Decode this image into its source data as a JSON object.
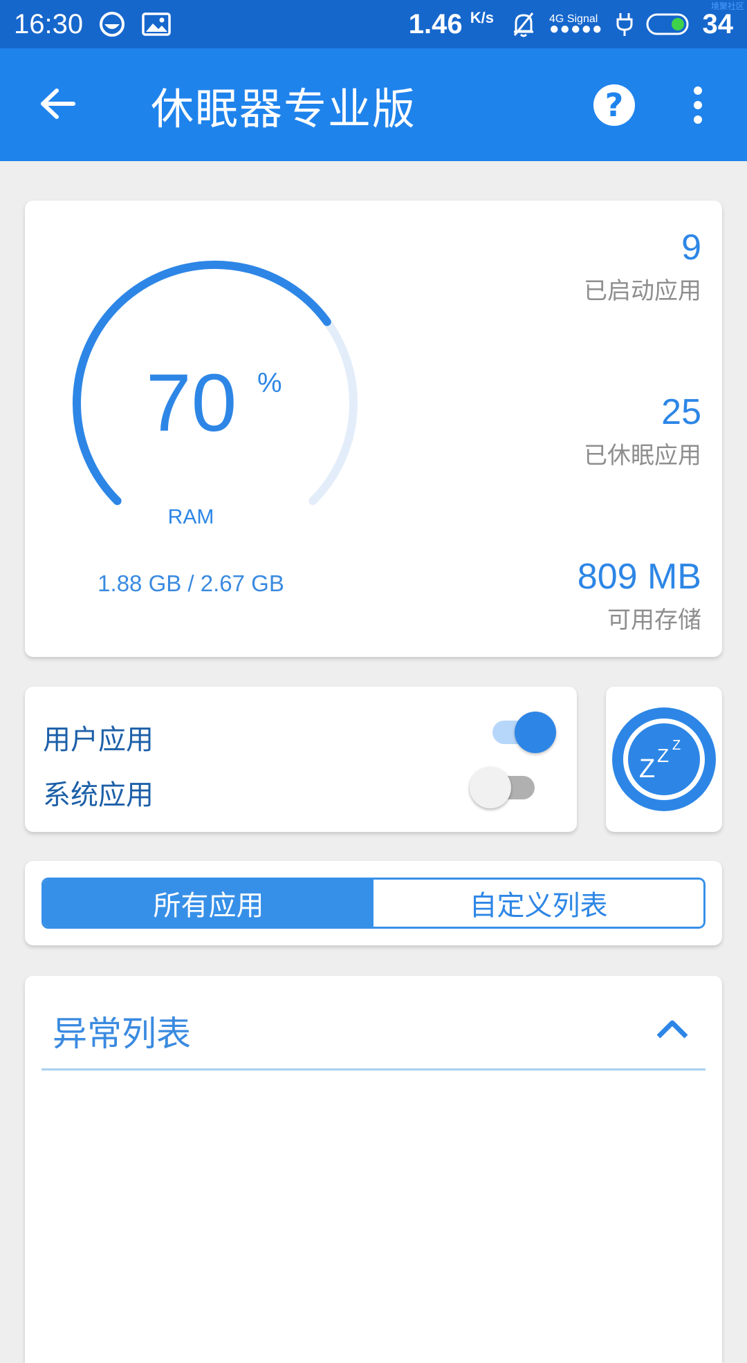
{
  "status_bar": {
    "time": "16:30",
    "speed_value": "1.46",
    "speed_unit": "K/s",
    "network_label": "4G",
    "signal_label": "Signal",
    "battery_level": "34",
    "watermark": "境聚社区"
  },
  "app_bar": {
    "title": "休眠器专业版",
    "help_symbol": "?"
  },
  "ram": {
    "percent_value": "70",
    "percent_sign": "%",
    "percent": 70,
    "label": "RAM",
    "usage": "1.88 GB / 2.67 GB"
  },
  "stats": [
    {
      "value": "9",
      "label": "已启动应用"
    },
    {
      "value": "25",
      "label": "已休眠应用"
    },
    {
      "value": "809 MB",
      "label": "可用存储"
    }
  ],
  "toggles": {
    "user_apps_label": "用户应用",
    "user_apps_on": true,
    "system_apps_label": "系统应用",
    "system_apps_on": false
  },
  "sleep_button": {
    "glyphs": [
      "Z",
      "Z",
      "Z"
    ]
  },
  "tabs": [
    {
      "label": "所有应用",
      "active": true
    },
    {
      "label": "自定义列表",
      "active": false
    }
  ],
  "abnormal_list": {
    "title": "异常列表"
  },
  "colors": {
    "status_bar": "#1667cc",
    "app_bar": "#1f83ec",
    "accent": "#2d86e6",
    "gauge_track": "#e3edfa"
  }
}
